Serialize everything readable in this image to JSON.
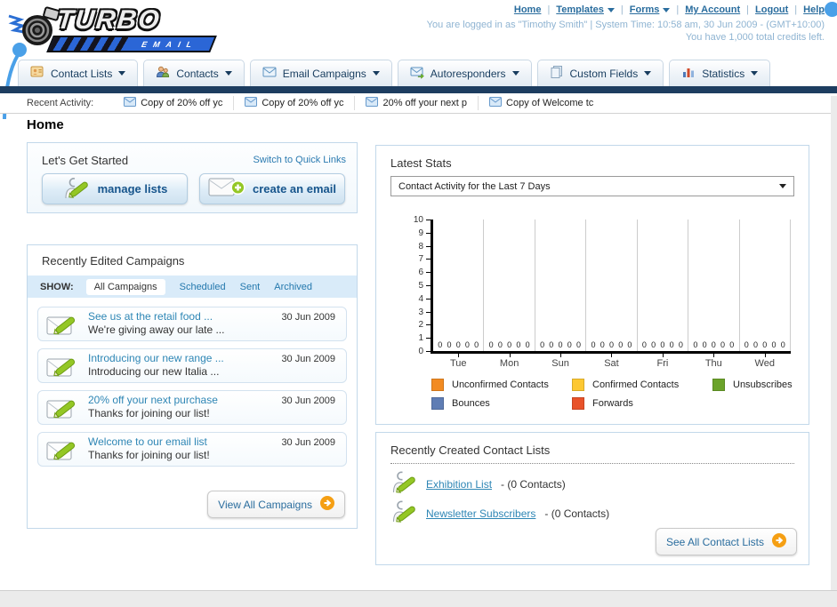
{
  "header": {
    "logo": {
      "line1": "TURBO",
      "line2": "EMAIL"
    },
    "nav_links": [
      {
        "label": "Home",
        "dropdown": false
      },
      {
        "label": "Templates",
        "dropdown": true
      },
      {
        "label": "Forms",
        "dropdown": true
      },
      {
        "label": "My Account",
        "dropdown": false
      },
      {
        "label": "Logout",
        "dropdown": false
      },
      {
        "label": "Help",
        "dropdown": false
      }
    ],
    "login_info": "You are logged in as \"Timothy Smith\" | System Time: 10:58 am, 30 Jun 2009 - (GMT+10:00)",
    "credits_info": "You have 1,000 total credits left."
  },
  "nav_tabs": [
    {
      "label": "Contact Lists",
      "icon": "contact-lists"
    },
    {
      "label": "Contacts",
      "icon": "contacts"
    },
    {
      "label": "Email Campaigns",
      "icon": "email-campaigns"
    },
    {
      "label": "Autoresponders",
      "icon": "autoresponders"
    },
    {
      "label": "Custom Fields",
      "icon": "custom-fields"
    },
    {
      "label": "Statistics",
      "icon": "statistics"
    }
  ],
  "recent_activity": {
    "label": "Recent Activity:",
    "items": [
      "Copy of 20% off yc",
      "Copy of 20% off yc",
      "20% off your next p",
      "Copy of Welcome tc"
    ]
  },
  "main": {
    "page_title": "Home",
    "get_started": {
      "title": "Let's Get Started",
      "switch_link": "Switch to Quick Links",
      "buttons": [
        {
          "label": "manage lists",
          "icon": "manage-lists"
        },
        {
          "label": "create an email",
          "icon": "create-email"
        }
      ]
    },
    "campaigns": {
      "title": "Recently Edited Campaigns",
      "show_label": "SHOW:",
      "filters": [
        {
          "label": "All Campaigns",
          "active": true
        },
        {
          "label": "Scheduled",
          "active": false
        },
        {
          "label": "Sent",
          "active": false
        },
        {
          "label": "Archived",
          "active": false
        }
      ],
      "items": [
        {
          "title": "See us at the retail food ...",
          "subtitle": "We're giving away our late ...",
          "date": "30 Jun 2009"
        },
        {
          "title": "Introducing our new range ...",
          "subtitle": "Introducing our new Italia ...",
          "date": "30 Jun 2009"
        },
        {
          "title": "20% off your next purchase",
          "subtitle": "Thanks for joining our list!",
          "date": "30 Jun 2009"
        },
        {
          "title": "Welcome to our email list",
          "subtitle": "Thanks for joining our list!",
          "date": "30 Jun 2009"
        }
      ],
      "view_all_label": "View All Campaigns"
    },
    "stats": {
      "title": "Latest Stats",
      "dropdown_value": "Contact Activity for the Last 7 Days"
    },
    "contact_lists": {
      "title": "Recently Created Contact Lists",
      "items": [
        {
          "name": "Exhibition List",
          "detail": "- (0 Contacts)"
        },
        {
          "name": "Newsletter Subscribers",
          "detail": "- (0 Contacts)"
        }
      ],
      "see_all_label": "See All Contact Lists"
    }
  },
  "chart_data": {
    "type": "bar",
    "title": "Contact Activity for the Last 7 Days",
    "categories": [
      "Tue",
      "Mon",
      "Sun",
      "Sat",
      "Fri",
      "Thu",
      "Wed"
    ],
    "series": [
      {
        "name": "Unconfirmed Contacts",
        "color": "#f28b22",
        "values": [
          0,
          0,
          0,
          0,
          0,
          0,
          0
        ]
      },
      {
        "name": "Confirmed Contacts",
        "color": "#fdc832",
        "values": [
          0,
          0,
          0,
          0,
          0,
          0,
          0
        ]
      },
      {
        "name": "Unsubscribes",
        "color": "#6ba32a",
        "values": [
          0,
          0,
          0,
          0,
          0,
          0,
          0
        ]
      },
      {
        "name": "Bounces",
        "color": "#5f7db4",
        "values": [
          0,
          0,
          0,
          0,
          0,
          0,
          0
        ]
      },
      {
        "name": "Forwards",
        "color": "#e8522a",
        "values": [
          0,
          0,
          0,
          0,
          0,
          0,
          0
        ]
      }
    ],
    "xlabel": "",
    "ylabel": "",
    "ylim": [
      0,
      10
    ],
    "yticks": [
      0,
      1,
      2,
      3,
      4,
      5,
      6,
      7,
      8,
      9,
      10
    ],
    "grid": "vertical-separators",
    "legend_position": "bottom",
    "value_labels": "each bar shows 0 above x-axis"
  },
  "colors": {
    "navy_bar": "#1d3d60",
    "link_blue": "#2a6d9e",
    "item_link": "#2e86b5",
    "panel_border": "#c2d8ea",
    "show_bar_bg": "#d9ebf9",
    "accent_orange": "#f59f13",
    "page_bg": "#ebebeb"
  }
}
